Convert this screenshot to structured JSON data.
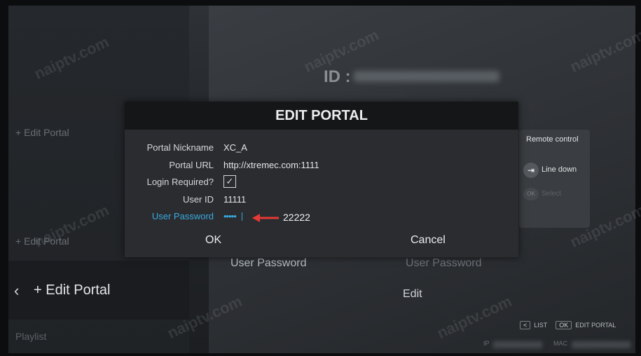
{
  "background": {
    "left_items": [
      "+ Edit Portal",
      "+ Edit Portal"
    ],
    "selected_item": "+ Edit Portal",
    "back_glyph": "‹",
    "playlist": "Playlist",
    "id_label": "ID :",
    "user_password_left": "User Password",
    "user_password_right": "User Password",
    "edit_label": "Edit",
    "remote": {
      "title": "Remote control",
      "line_down_key": "⇥",
      "line_down": "Line down",
      "ok_key": "OK",
      "select": "Select"
    },
    "footer": {
      "back_key": "<",
      "list": "LIST",
      "ok_key": "OK",
      "edit_portal": "EDIT PORTAL",
      "ip": "IP",
      "mac": "MAC"
    },
    "watermark": "naiptv.com"
  },
  "dialog": {
    "title": "EDIT PORTAL",
    "fields": {
      "nickname_label": "Portal Nickname",
      "nickname_value": "XC_A",
      "url_label": "Portal URL",
      "url_value": "http://xtremec.com:1111",
      "login_label": "Login Required?",
      "login_checked": "✓",
      "userid_label": "User ID",
      "userid_value": "11111",
      "password_label": "User Password",
      "password_value": "•••••"
    },
    "annotation": "22222",
    "ok": "OK",
    "cancel": "Cancel"
  },
  "colors": {
    "accent": "#3aa9e0",
    "arrow": "#e53935"
  }
}
